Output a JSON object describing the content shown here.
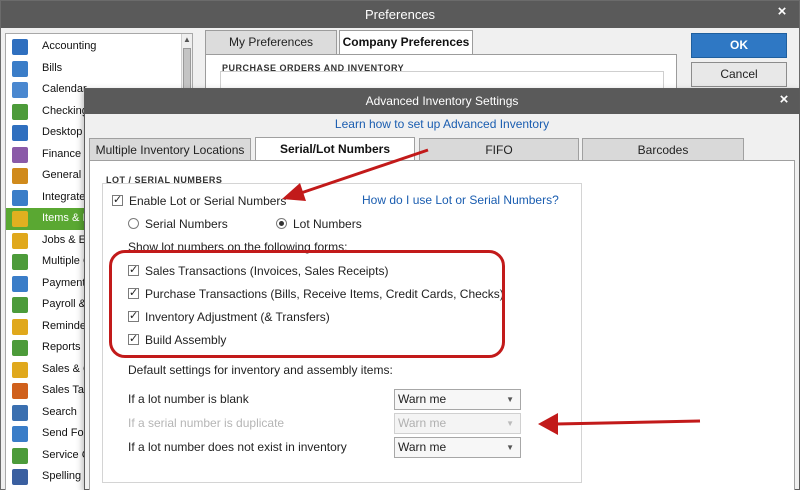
{
  "preferences": {
    "title": "Preferences",
    "close": "×",
    "sidebar": [
      {
        "label": "Accounting",
        "icon": "accounting-icon",
        "color": "#2f6fbf"
      },
      {
        "label": "Bills",
        "icon": "bills-icon",
        "color": "#3a7dc8"
      },
      {
        "label": "Calendar",
        "icon": "calendar-icon",
        "color": "#4a88d0"
      },
      {
        "label": "Checking",
        "icon": "checking-icon",
        "color": "#4c9b3a"
      },
      {
        "label": "Desktop V",
        "icon": "desktop-view-icon",
        "color": "#2f6fbf"
      },
      {
        "label": "Finance C",
        "icon": "finance-charge-icon",
        "color": "#8a5aa8"
      },
      {
        "label": "General",
        "icon": "general-icon",
        "color": "#d08a1c"
      },
      {
        "label": "Integrated",
        "icon": "integrated-apps-icon",
        "color": "#3a7dc8"
      },
      {
        "label": "Items & In",
        "icon": "items-inventory-icon",
        "color": "#e0b020",
        "selected": true
      },
      {
        "label": "Jobs & E",
        "icon": "jobs-estimates-icon",
        "color": "#e0a81c"
      },
      {
        "label": "Multiple C",
        "icon": "multiple-currencies-icon",
        "color": "#4c9b3a"
      },
      {
        "label": "Payments",
        "icon": "payments-icon",
        "color": "#3a7dc8"
      },
      {
        "label": "Payroll &",
        "icon": "payroll-icon",
        "color": "#4c9b3a"
      },
      {
        "label": "Reminder",
        "icon": "reminders-icon",
        "color": "#e0a81c"
      },
      {
        "label": "Reports &",
        "icon": "reports-graphs-icon",
        "color": "#4c9b3a"
      },
      {
        "label": "Sales & C",
        "icon": "sales-customers-icon",
        "color": "#e0a81c"
      },
      {
        "label": "Sales Tax",
        "icon": "sales-tax-icon",
        "color": "#d0601c"
      },
      {
        "label": "Search",
        "icon": "search-icon",
        "color": "#3a6fb0"
      },
      {
        "label": "Send For",
        "icon": "send-forms-icon",
        "color": "#3a7dc8"
      },
      {
        "label": "Service C",
        "icon": "service-connection-icon",
        "color": "#4c9b3a"
      },
      {
        "label": "Spelling",
        "icon": "spelling-icon",
        "color": "#3a5fa0"
      }
    ],
    "tabs": {
      "my": "My Preferences",
      "company": "Company Preferences"
    },
    "section_heading": "PURCHASE ORDERS AND INVENTORY",
    "ok": "OK",
    "cancel": "Cancel"
  },
  "advanced": {
    "title": "Advanced Inventory Settings",
    "close": "×",
    "learn_link": "Learn how to set up Advanced Inventory",
    "tabs": [
      "Multiple Inventory Locations",
      "Serial/Lot Numbers",
      "FIFO",
      "Barcodes"
    ],
    "active_tab": "Serial/Lot Numbers",
    "section_heading": "LOT / SERIAL NUMBERS",
    "enable_label": "Enable Lot or Serial Numbers",
    "enable_checked": true,
    "help_link": "How do I use Lot or Serial Numbers?",
    "radio_serial": "Serial Numbers",
    "radio_lot": "Lot Numbers",
    "selected_radio": "Lot Numbers",
    "show_label": "Show lot numbers on the following forms:",
    "forms": [
      {
        "label": "Sales Transactions (Invoices, Sales Receipts)",
        "checked": true
      },
      {
        "label": "Purchase Transactions (Bills, Receive Items, Credit Cards, Checks)",
        "checked": true
      },
      {
        "label": "Inventory Adjustment (& Transfers)",
        "checked": true
      },
      {
        "label": "Build Assembly",
        "checked": true
      }
    ],
    "default_label": "Default settings for inventory and assembly items:",
    "settings": [
      {
        "label": "If a lot number is blank",
        "value": "Warn me",
        "disabled": false
      },
      {
        "label": "If a serial number is duplicate",
        "value": "Warn me",
        "disabled": true
      },
      {
        "label": "If a lot number does not exist in inventory",
        "value": "Warn me",
        "disabled": false
      }
    ]
  },
  "annotation_color": "#c21a1a"
}
